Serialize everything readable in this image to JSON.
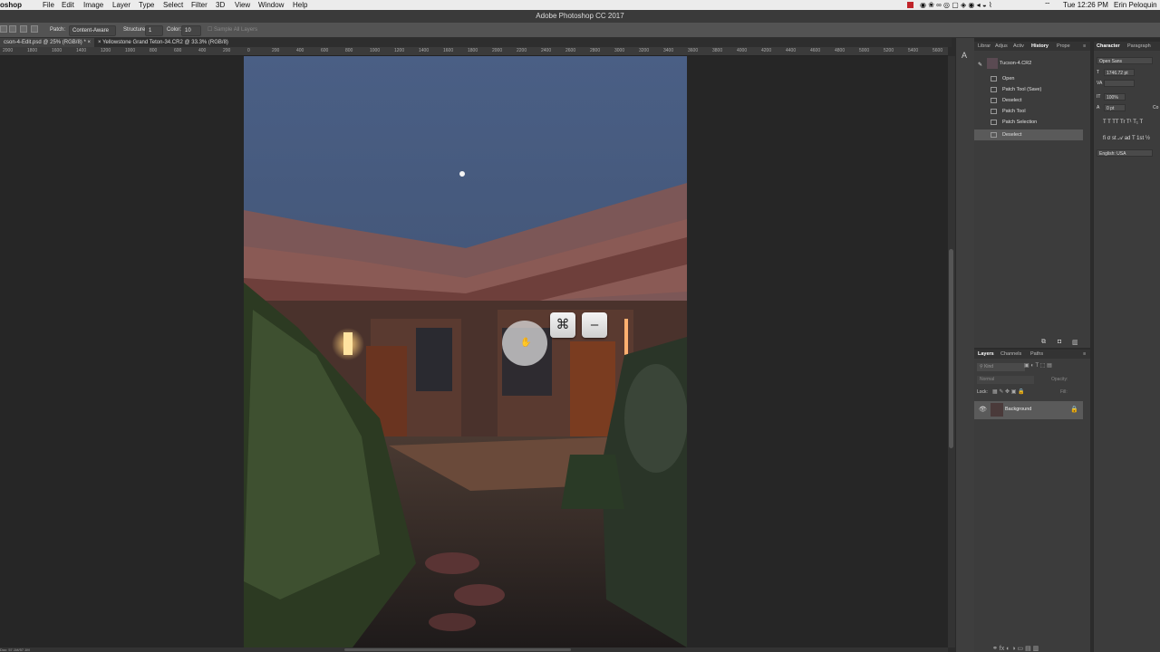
{
  "menubar": {
    "app_name": "oshop CC",
    "items": [
      "File",
      "Edit",
      "Image",
      "Layer",
      "Type",
      "Select",
      "Filter",
      "3D",
      "View",
      "Window",
      "Help"
    ],
    "clock": "Tue 12:26 PM",
    "user": "Erin Peloquin"
  },
  "window_title": "Adobe Photoshop CC 2017",
  "options": {
    "patch_label": "Patch:",
    "patch_value": "Content-Aware",
    "structure_label": "Structure:",
    "structure_value": "1",
    "color_label": "Color:",
    "color_value": "10",
    "sample_all_layers": "Sample All Layers"
  },
  "tabs": [
    {
      "label": "cson-4-Edit.psd @ 25% (RGB/8) *"
    },
    {
      "label": "Yellowstone Grand Teton-34.CR2 @ 33.3% (RGB/8)"
    }
  ],
  "ruler": [
    "2000",
    "1800",
    "1600",
    "1400",
    "1200",
    "1000",
    "800",
    "600",
    "400",
    "200",
    "0",
    "200",
    "400",
    "600",
    "800",
    "1000",
    "1200",
    "1400",
    "1600",
    "1800",
    "2000",
    "2200",
    "2400",
    "2600",
    "2800",
    "3000",
    "3200",
    "3400",
    "3600",
    "3800",
    "4000",
    "4200",
    "4400",
    "4600",
    "4800",
    "5000",
    "5200",
    "5400",
    "5600"
  ],
  "status": "Doc: 57.1M/57.1M",
  "keyboard": {
    "cmd": "⌘",
    "minus": "–"
  },
  "history_panel": {
    "tabs": [
      "Librar",
      "Adjus",
      "Activ",
      "History",
      "Prope"
    ],
    "snapshot": "Tucson-4.CR2",
    "items": [
      "Open",
      "Patch Tool (Save)",
      "Deselect",
      "Patch Tool",
      "Patch Selection",
      "Deselect"
    ]
  },
  "layers_panel": {
    "tabs": [
      "Layers",
      "Channels",
      "Paths"
    ],
    "kind_placeholder": "Kind",
    "blend_mode": "Normal",
    "opacity_label": "Opacity:",
    "lock_label": "Lock:",
    "fill_label": "Fill:",
    "layers": [
      {
        "name": "Background"
      }
    ]
  },
  "character_panel": {
    "tabs": [
      "Character",
      "Paragraph"
    ],
    "font": "Open Sans",
    "size": "1746.72 pt",
    "scale": "100%",
    "baseline": "0 pt",
    "language": "English: USA",
    "col_label": "Co"
  }
}
